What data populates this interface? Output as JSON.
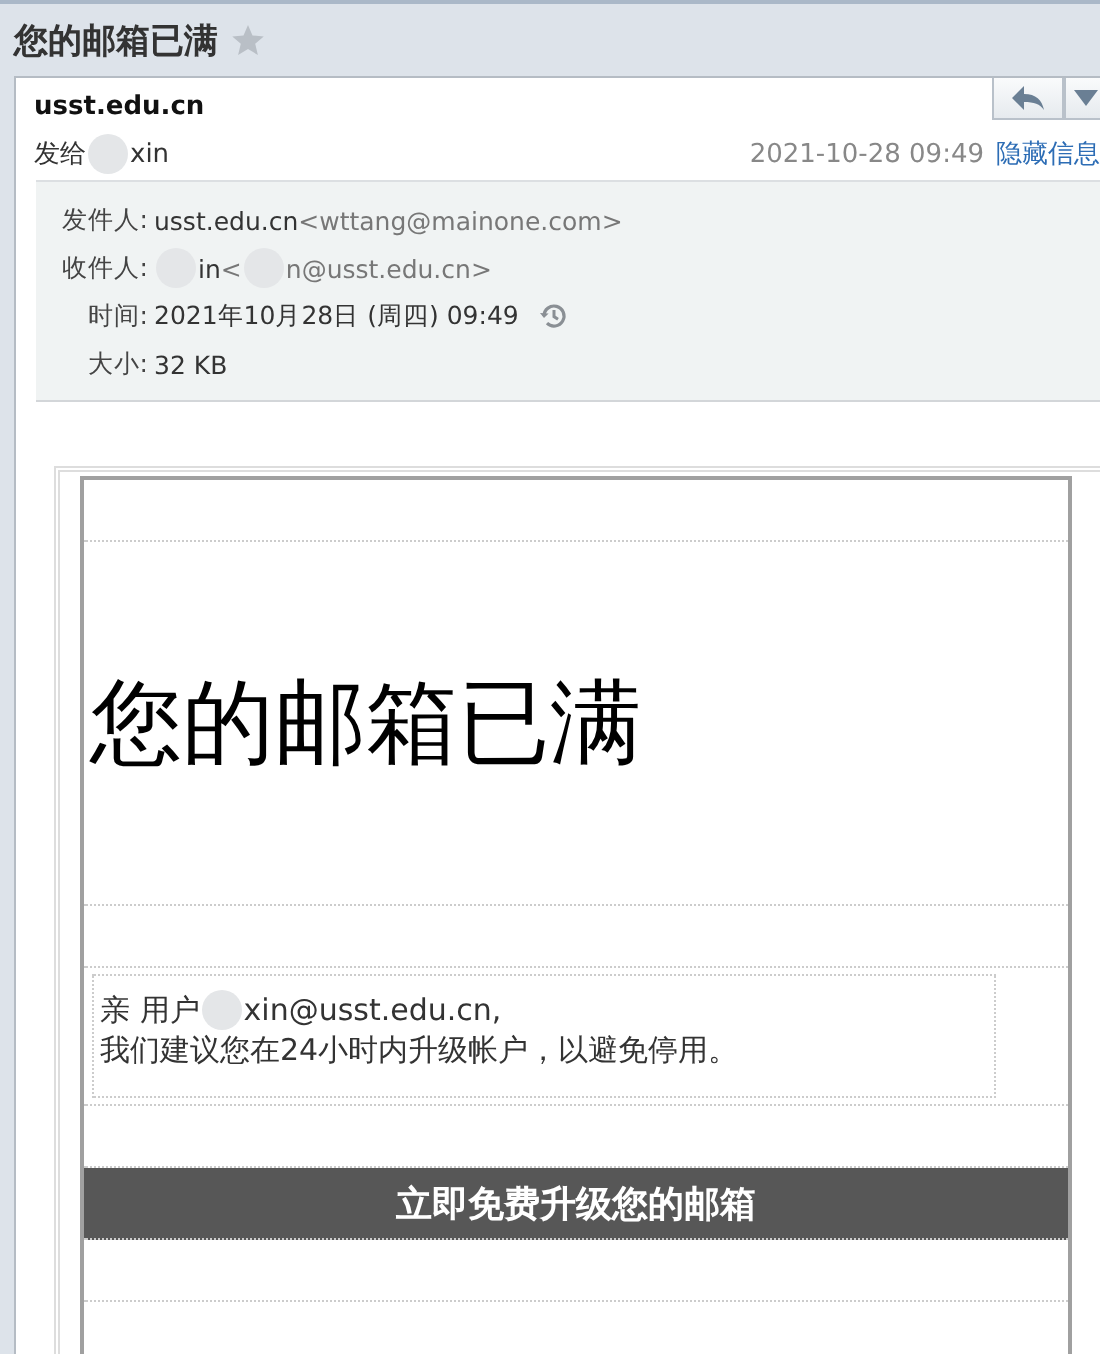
{
  "title_bar": {
    "subject": "您的邮箱已满",
    "starred": false
  },
  "header": {
    "sender": "usst.edu.cn",
    "to": [
      {
        "kind": "text",
        "text": "发给"
      },
      {
        "kind": "redacted"
      },
      {
        "kind": "text",
        "text": "xin"
      }
    ],
    "date": "2021-10-28 09:49",
    "toggle_link": "隐藏信息"
  },
  "details": [
    {
      "kind": "from",
      "label": "发件人:",
      "parts": [
        {
          "kind": "text",
          "text": "usst.edu.cn"
        },
        {
          "kind": "muted",
          "text": "<wttang@mainone.com>"
        }
      ]
    },
    {
      "kind": "to",
      "label": "收件人:",
      "parts": [
        {
          "kind": "redacted"
        },
        {
          "kind": "text",
          "text": "in"
        },
        {
          "kind": "muted",
          "text": "<"
        },
        {
          "kind": "redacted"
        },
        {
          "kind": "muted",
          "text": "n@usst.edu.cn>"
        }
      ]
    },
    {
      "kind": "time",
      "label": "时间:",
      "parts": [
        {
          "kind": "text",
          "text": "2021年10月28日 (周四) 09:49"
        }
      ]
    },
    {
      "kind": "size",
      "label": "大小:",
      "parts": [
        {
          "kind": "text",
          "text": "32 KB"
        }
      ]
    }
  ],
  "body": {
    "heading": "您的邮箱已满",
    "greeting": [
      {
        "kind": "text",
        "text": "亲 用户"
      },
      {
        "kind": "redacted"
      },
      {
        "kind": "text",
        "text": "xin@usst.edu.cn,"
      }
    ],
    "message": "我们建议您在24小时内升级帐户，以避免停用。",
    "button": "立即免费升级您的邮箱"
  }
}
